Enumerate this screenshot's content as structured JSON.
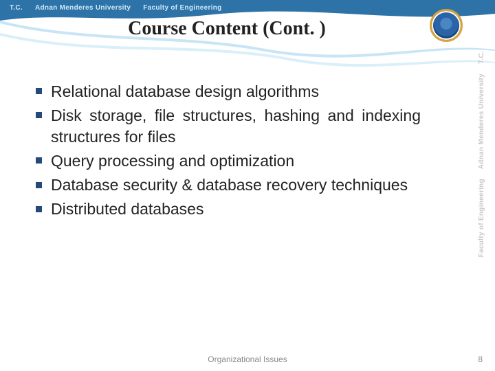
{
  "banner": {
    "tc": "T.C.",
    "university": "Adnan Menderes University",
    "faculty": "Faculty of Engineering"
  },
  "rail": {
    "tc": "T.C.",
    "university": "Adnan Menderes University",
    "faculty": "Faculty of Engineering"
  },
  "title": "Course Content (Cont. )",
  "bullets": [
    "Relational database design algorithms",
    "Disk storage, file structures, hashing and indexing structures for files",
    "Query processing and optimization",
    "Database security & database recovery techniques",
    "Distributed databases"
  ],
  "footer": "Organizational Issues",
  "page": "8"
}
